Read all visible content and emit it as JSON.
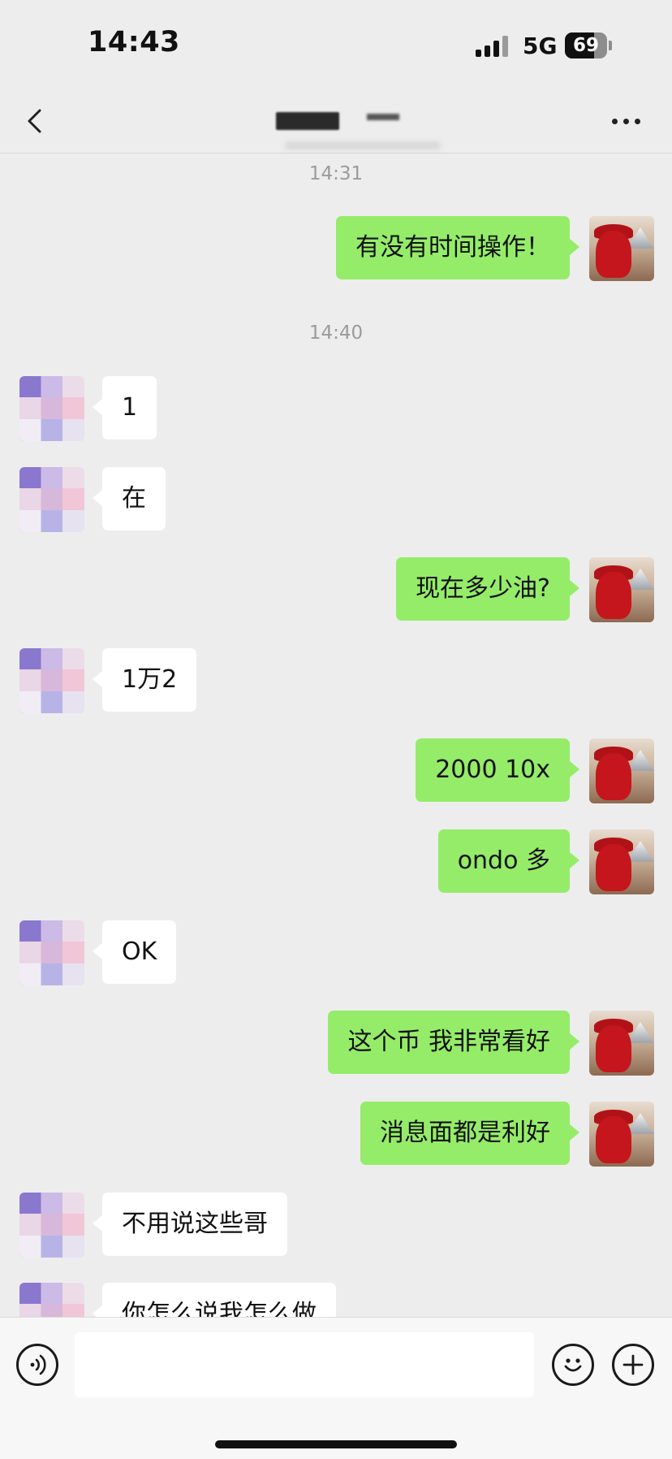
{
  "status_bar": {
    "time": "14:43",
    "network": "5G",
    "battery_level": "69",
    "signal_icon": "signal-bars-icon",
    "battery_icon": "battery-icon"
  },
  "header": {
    "back_icon": "chevron-left-icon",
    "title_redacted": true,
    "more_icon": "ellipsis-icon"
  },
  "colors": {
    "background": "#ededed",
    "my_bubble": "#95ec69",
    "other_bubble": "#ffffff",
    "timestamp_text": "#9b9b9b"
  },
  "messages": {
    "ts1": "14:31",
    "m1": "有没有时间操作！",
    "ts2": "14:40",
    "m2": "1",
    "m3": "在",
    "m4": "现在多少油?",
    "m5": "1万2",
    "m6": "2000 10x",
    "m7": "ondo 多",
    "m8": "OK",
    "m9": "这个币 我非常看好",
    "m10": "消息面都是利好",
    "m11": "不用说这些哥",
    "m12": "你怎么说我怎么做"
  },
  "input_bar": {
    "voice_icon": "voice-icon",
    "message_value": "",
    "emoji_icon": "smiley-icon",
    "plus_icon": "plus-icon"
  }
}
